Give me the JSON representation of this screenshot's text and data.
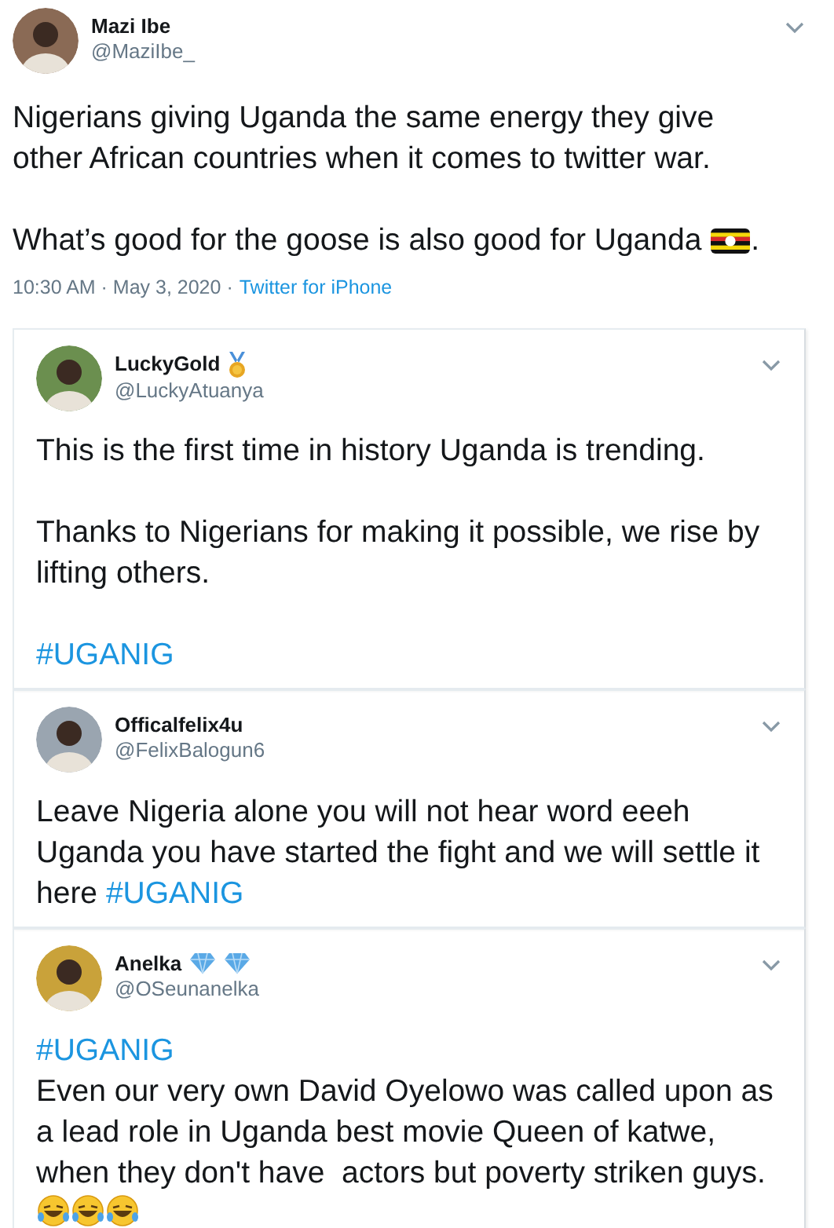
{
  "main_tweet": {
    "name": "Mazi Ibe",
    "handle": "@MaziIbe_",
    "paragraphs": [
      [
        {
          "kind": "text",
          "text": "Nigerians giving Uganda the same energy they give other African countries when it comes to twitter war."
        }
      ],
      [
        {
          "kind": "text",
          "text": "What’s good for the goose is also good for Uganda "
        },
        {
          "kind": "flag"
        },
        {
          "kind": "text",
          "text": "."
        }
      ]
    ],
    "time": "10:30 AM · May 3, 2020 ·",
    "source": "Twitter for iPhone"
  },
  "replies": [
    {
      "name": "LuckyGold",
      "handle": "@LuckyAtuanya",
      "badges": [
        {
          "kind": "medal"
        }
      ],
      "paragraphs": [
        [
          {
            "kind": "text",
            "text": "This is the first time in history Uganda is trending."
          }
        ],
        [
          {
            "kind": "text",
            "text": "Thanks to Nigerians for making it possible, we rise by lifting others."
          }
        ],
        [
          {
            "kind": "hashtag",
            "text": "#UGANIG"
          }
        ]
      ]
    },
    {
      "name": "Officalfelix4u",
      "handle": "@FelixBalogun6",
      "paragraphs": [
        [
          {
            "kind": "text",
            "text": "Leave Nigeria alone you will not hear word eeeh Uganda you have started the fight and we will settle it here "
          },
          {
            "kind": "hashtag",
            "text": "#UGANIG"
          }
        ]
      ]
    },
    {
      "name": "Anelka",
      "handle": "@OSeunanelka",
      "badges": [
        {
          "kind": "diamond"
        },
        {
          "kind": "diamond"
        }
      ],
      "paragraphs": [
        [
          {
            "kind": "hashtag",
            "text": "#UGANIG"
          },
          {
            "kind": "break"
          },
          {
            "kind": "text",
            "text": "Even our very own David Oyelowo was called upon as a lead role in Uganda best movie Queen of katwe, when they don't have  actors but poverty striken guys."
          },
          {
            "kind": "laugh"
          },
          {
            "kind": "laugh"
          },
          {
            "kind": "laugh"
          }
        ]
      ]
    }
  ]
}
